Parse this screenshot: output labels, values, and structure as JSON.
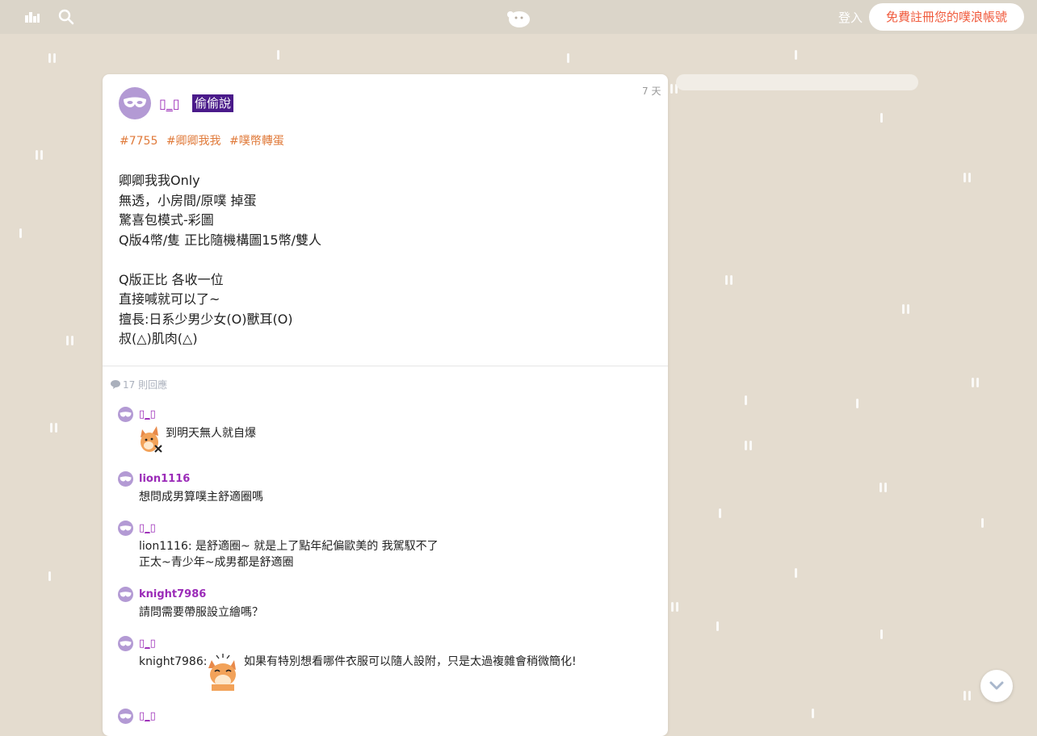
{
  "topbar": {
    "login_label": "登入",
    "register_label": "免費註冊您的噗浪帳號"
  },
  "post": {
    "author": "▯_▯",
    "badge": "偷偷說",
    "time": "7 天",
    "tags": [
      "#7755",
      "#卿卿我我",
      "#噗幣轉蛋"
    ],
    "body": "卿卿我我Only\n無透，小房間/原噗 掉蛋\n驚喜包模式-彩圖\nQ版4幣/隻 正比隨機構圖15幣/雙人\n\nQ版正比 各收一位\n直接喊就可以了~\n擅長:日系少男少女(O)獸耳(O)\n叔(△)肌肉(△)"
  },
  "responses": {
    "count_label": "17 則回應",
    "items": [
      {
        "author": "▯_▯",
        "text": "到明天無人就自爆"
      },
      {
        "author": "lion1116",
        "text": "想問成男算噗主舒適圈嗎"
      },
      {
        "author": "▯_▯",
        "text": "lion1116: 是舒適圈~ 就是上了點年紀偏歐美的 我駕馭不了",
        "text2": "正太~青少年~成男都是舒適圈"
      },
      {
        "author": "knight7986",
        "text": "請問需要帶服設立繪嗎？"
      },
      {
        "author": "▯_▯",
        "prefix": "knight7986:",
        "text": "如果有特別想看哪件衣服可以隨人設附，只是太過複雜會稍微簡化!"
      },
      {
        "author": "▯_▯",
        "text": ""
      }
    ]
  },
  "colors": {
    "background": "#e4dccf",
    "topbar": "#dbd5c9",
    "accent_register": "#f05a3c",
    "username": "#9b2bb8",
    "badge_bg": "#4a1a8a",
    "tag": "#e07a3a",
    "avatar": "#b39ad4"
  },
  "icons": [
    "home-icon",
    "search-icon",
    "plurk-logo-icon",
    "comment-icon",
    "mask-avatar-icon",
    "chevron-down-icon"
  ]
}
